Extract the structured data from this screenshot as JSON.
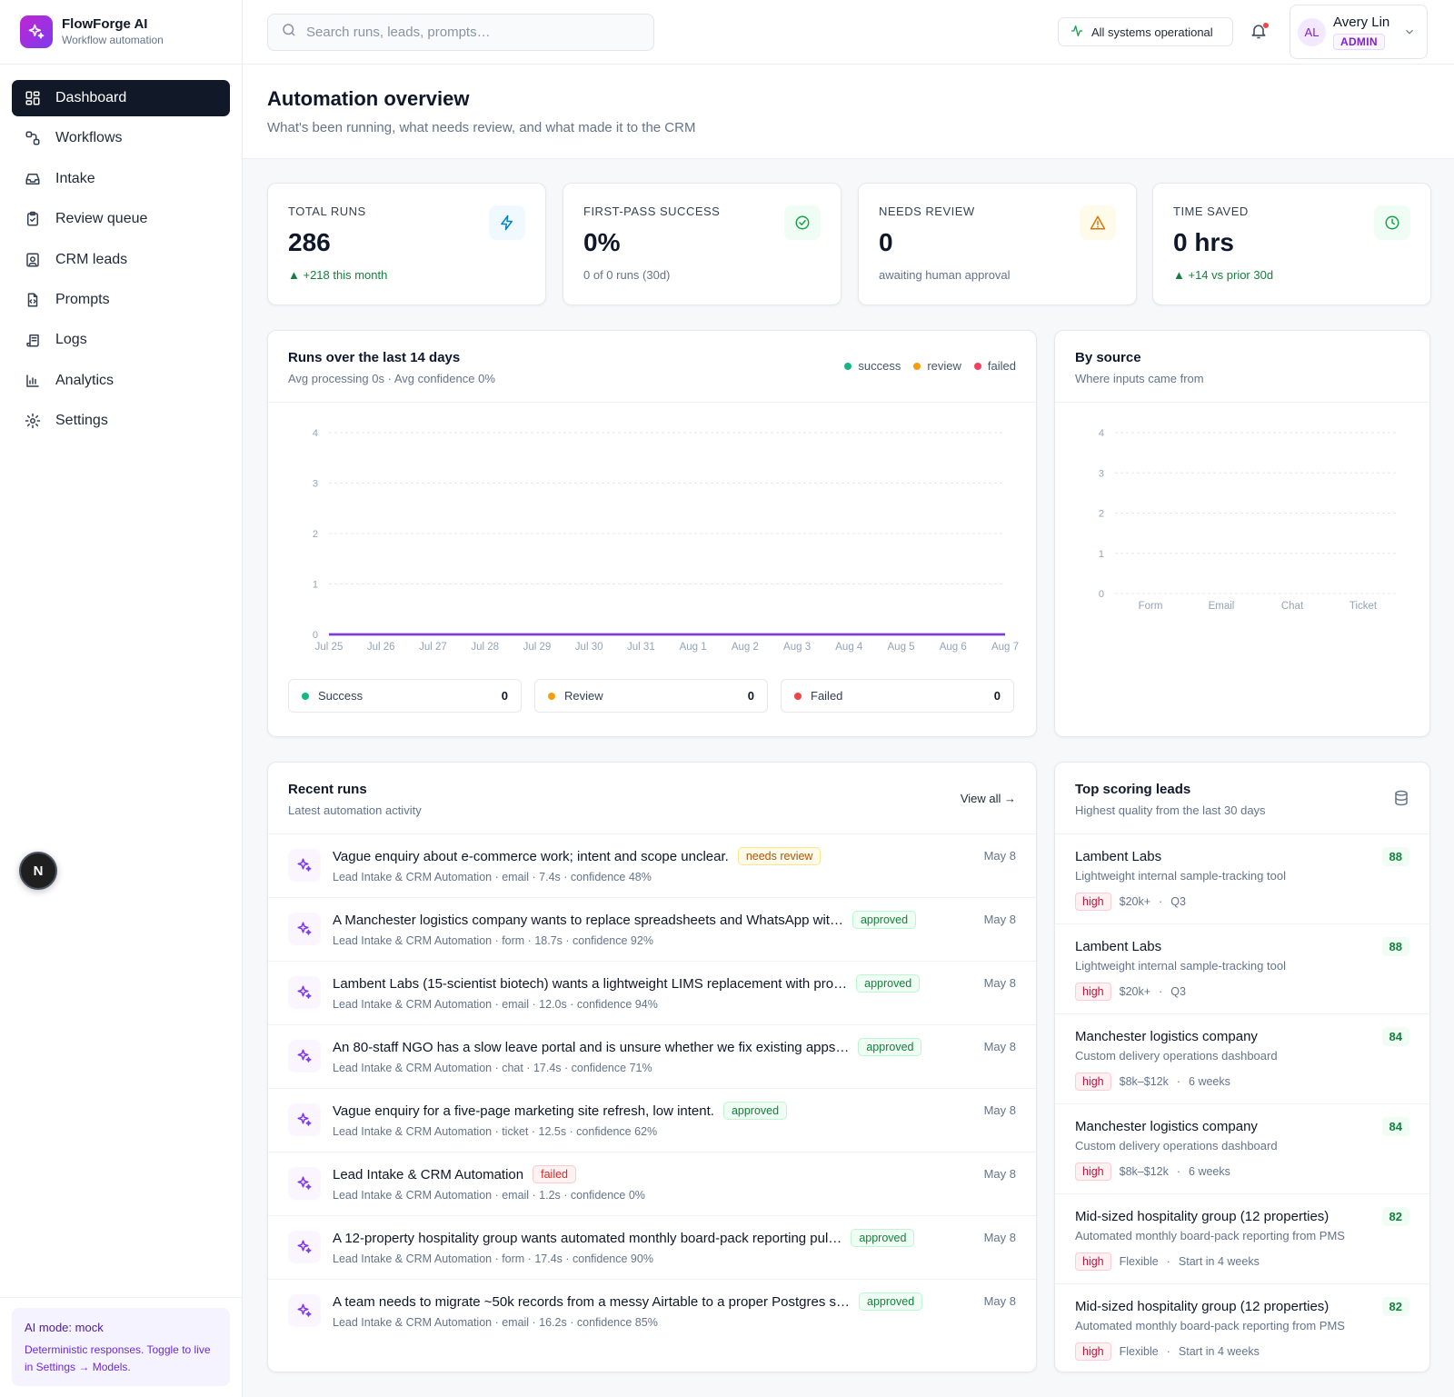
{
  "brand": {
    "name": "FlowForge AI",
    "subtitle": "Workflow automation"
  },
  "nav": {
    "items": [
      {
        "label": "Dashboard",
        "icon": "dashboard-icon",
        "active": true
      },
      {
        "label": "Workflows",
        "icon": "workflow-icon"
      },
      {
        "label": "Intake",
        "icon": "inbox-icon"
      },
      {
        "label": "Review queue",
        "icon": "clipboard-check-icon"
      },
      {
        "label": "CRM leads",
        "icon": "contact-icon"
      },
      {
        "label": "Prompts",
        "icon": "file-code-icon"
      },
      {
        "label": "Logs",
        "icon": "scroll-icon"
      },
      {
        "label": "Analytics",
        "icon": "bar-chart-icon"
      },
      {
        "label": "Settings",
        "icon": "gear-icon"
      }
    ]
  },
  "ai_mode": {
    "title": "AI mode: mock",
    "text": "Deterministic responses. Toggle to live in Settings → Models."
  },
  "floating_badge": "N",
  "topbar": {
    "search_placeholder": "Search runs, leads, prompts…",
    "status": "All systems operational",
    "user": {
      "initials": "AL",
      "name": "Avery Lin",
      "role": "ADMIN"
    }
  },
  "header": {
    "title": "Automation overview",
    "subtitle": "What's been running, what needs review, and what made it to the CRM"
  },
  "kpis": [
    {
      "label": "TOTAL RUNS",
      "value": "286",
      "foot": "▲ +218 this month",
      "trend": "up",
      "icon": "lightning-icon",
      "color": "#0284c7",
      "bg": "#f0f9ff"
    },
    {
      "label": "FIRST-PASS SUCCESS",
      "value": "0%",
      "foot": "0 of 0 runs (30d)",
      "trend": "neutral",
      "icon": "check-circle-icon",
      "color": "#16a34a",
      "bg": "#f0fdf4"
    },
    {
      "label": "NEEDS REVIEW",
      "value": "0",
      "foot": "awaiting human approval",
      "trend": "neutral",
      "icon": "warning-icon",
      "color": "#d97706",
      "bg": "#fffbeb"
    },
    {
      "label": "TIME SAVED",
      "value": "0 hrs",
      "foot": "▲ +14 vs prior 30d",
      "trend": "up",
      "icon": "clock-icon",
      "color": "#16a34a",
      "bg": "#f0fdf4"
    }
  ],
  "runs_chart": {
    "title": "Runs over the last 14 days",
    "subtitle": "Avg processing 0s · Avg confidence 0%",
    "legend": [
      {
        "name": "success",
        "color": "#10b981"
      },
      {
        "name": "review",
        "color": "#f59e0b"
      },
      {
        "name": "failed",
        "color": "#f43f5e"
      }
    ],
    "summary": [
      {
        "label": "Success",
        "value": "0",
        "color": "#10b981"
      },
      {
        "label": "Review",
        "value": "0",
        "color": "#f59e0b"
      },
      {
        "label": "Failed",
        "value": "0",
        "color": "#ef4444"
      }
    ]
  },
  "source_chart": {
    "title": "By source",
    "subtitle": "Where inputs came from"
  },
  "chart_data": [
    {
      "type": "line",
      "x": [
        "Jul 25",
        "Jul 26",
        "Jul 27",
        "Jul 28",
        "Jul 29",
        "Jul 30",
        "Jul 31",
        "Aug 1",
        "Aug 2",
        "Aug 3",
        "Aug 4",
        "Aug 5",
        "Aug 6",
        "Aug 7"
      ],
      "series": [
        {
          "name": "success",
          "values": [
            0,
            0,
            0,
            0,
            0,
            0,
            0,
            0,
            0,
            0,
            0,
            0,
            0,
            0
          ],
          "color": "#10b981"
        },
        {
          "name": "review",
          "values": [
            0,
            0,
            0,
            0,
            0,
            0,
            0,
            0,
            0,
            0,
            0,
            0,
            0,
            0
          ],
          "color": "#f59e0b"
        },
        {
          "name": "failed",
          "values": [
            0,
            0,
            0,
            0,
            0,
            0,
            0,
            0,
            0,
            0,
            0,
            0,
            0,
            0
          ],
          "color": "#7c3aed"
        }
      ],
      "yticks": [
        0,
        1,
        2,
        3,
        4
      ],
      "ylim": [
        0,
        4
      ],
      "grid": true
    },
    {
      "type": "bar",
      "categories": [
        "Form",
        "Email",
        "Chat",
        "Ticket"
      ],
      "values": [
        0,
        0,
        0,
        0
      ],
      "yticks": [
        0,
        1,
        2,
        3,
        4
      ],
      "ylim": [
        0,
        4
      ],
      "grid": true
    }
  ],
  "recent_runs": {
    "title": "Recent runs",
    "subtitle": "Latest automation activity",
    "view_all": "View all →",
    "items": [
      {
        "title": "Vague enquiry about e-commerce work; intent and scope unclear.",
        "status": "needs review",
        "kind": "review",
        "meta": "Lead Intake & CRM Automation · email · 7.4s · confidence 48%",
        "date": "May 8"
      },
      {
        "title": "A Manchester logistics company wants to replace spreadsheets and WhatsApp wit…",
        "status": "approved",
        "kind": "approved",
        "meta": "Lead Intake & CRM Automation · form · 18.7s · confidence 92%",
        "date": "May 8"
      },
      {
        "title": "Lambent Labs (15-scientist biotech) wants a lightweight LIMS replacement with pro…",
        "status": "approved",
        "kind": "approved",
        "meta": "Lead Intake & CRM Automation · email · 12.0s · confidence 94%",
        "date": "May 8"
      },
      {
        "title": "An 80-staff NGO has a slow leave portal and is unsure whether we fix existing apps…",
        "status": "approved",
        "kind": "approved",
        "meta": "Lead Intake & CRM Automation · chat · 17.4s · confidence 71%",
        "date": "May 8"
      },
      {
        "title": "Vague enquiry for a five-page marketing site refresh, low intent.",
        "status": "approved",
        "kind": "approved",
        "meta": "Lead Intake & CRM Automation · ticket · 12.5s · confidence 62%",
        "date": "May 8"
      },
      {
        "title": "Lead Intake & CRM Automation",
        "status": "failed",
        "kind": "failed",
        "meta": "Lead Intake & CRM Automation · email · 1.2s · confidence 0%",
        "date": "May 8"
      },
      {
        "title": "A 12-property hospitality group wants automated monthly board-pack reporting pul…",
        "status": "approved",
        "kind": "approved",
        "meta": "Lead Intake & CRM Automation · form · 17.4s · confidence 90%",
        "date": "May 8"
      },
      {
        "title": "A team needs to migrate ~50k records from a messy Airtable to a proper Postgres s…",
        "status": "approved",
        "kind": "approved",
        "meta": "Lead Intake & CRM Automation · email · 16.2s · confidence 85%",
        "date": "May 8"
      }
    ]
  },
  "top_leads": {
    "title": "Top scoring leads",
    "subtitle": "Highest quality from the last 30 days",
    "items": [
      {
        "name": "Lambent Labs",
        "desc": "Lightweight internal sample-tracking tool",
        "score": "88",
        "priority": "high",
        "budget": "$20k+",
        "timeline": "Q3"
      },
      {
        "name": "Lambent Labs",
        "desc": "Lightweight internal sample-tracking tool",
        "score": "88",
        "priority": "high",
        "budget": "$20k+",
        "timeline": "Q3"
      },
      {
        "name": "Manchester logistics company",
        "desc": "Custom delivery operations dashboard",
        "score": "84",
        "priority": "high",
        "budget": "$8k–$12k",
        "timeline": "6 weeks"
      },
      {
        "name": "Manchester logistics company",
        "desc": "Custom delivery operations dashboard",
        "score": "84",
        "priority": "high",
        "budget": "$8k–$12k",
        "timeline": "6 weeks"
      },
      {
        "name": "Mid-sized hospitality group (12 properties)",
        "desc": "Automated monthly board-pack reporting from PMS",
        "score": "82",
        "priority": "high",
        "budget": "Flexible",
        "timeline": "Start in 4 weeks"
      },
      {
        "name": "Mid-sized hospitality group (12 properties)",
        "desc": "Automated monthly board-pack reporting from PMS",
        "score": "82",
        "priority": "high",
        "budget": "Flexible",
        "timeline": "Start in 4 weeks"
      }
    ]
  }
}
